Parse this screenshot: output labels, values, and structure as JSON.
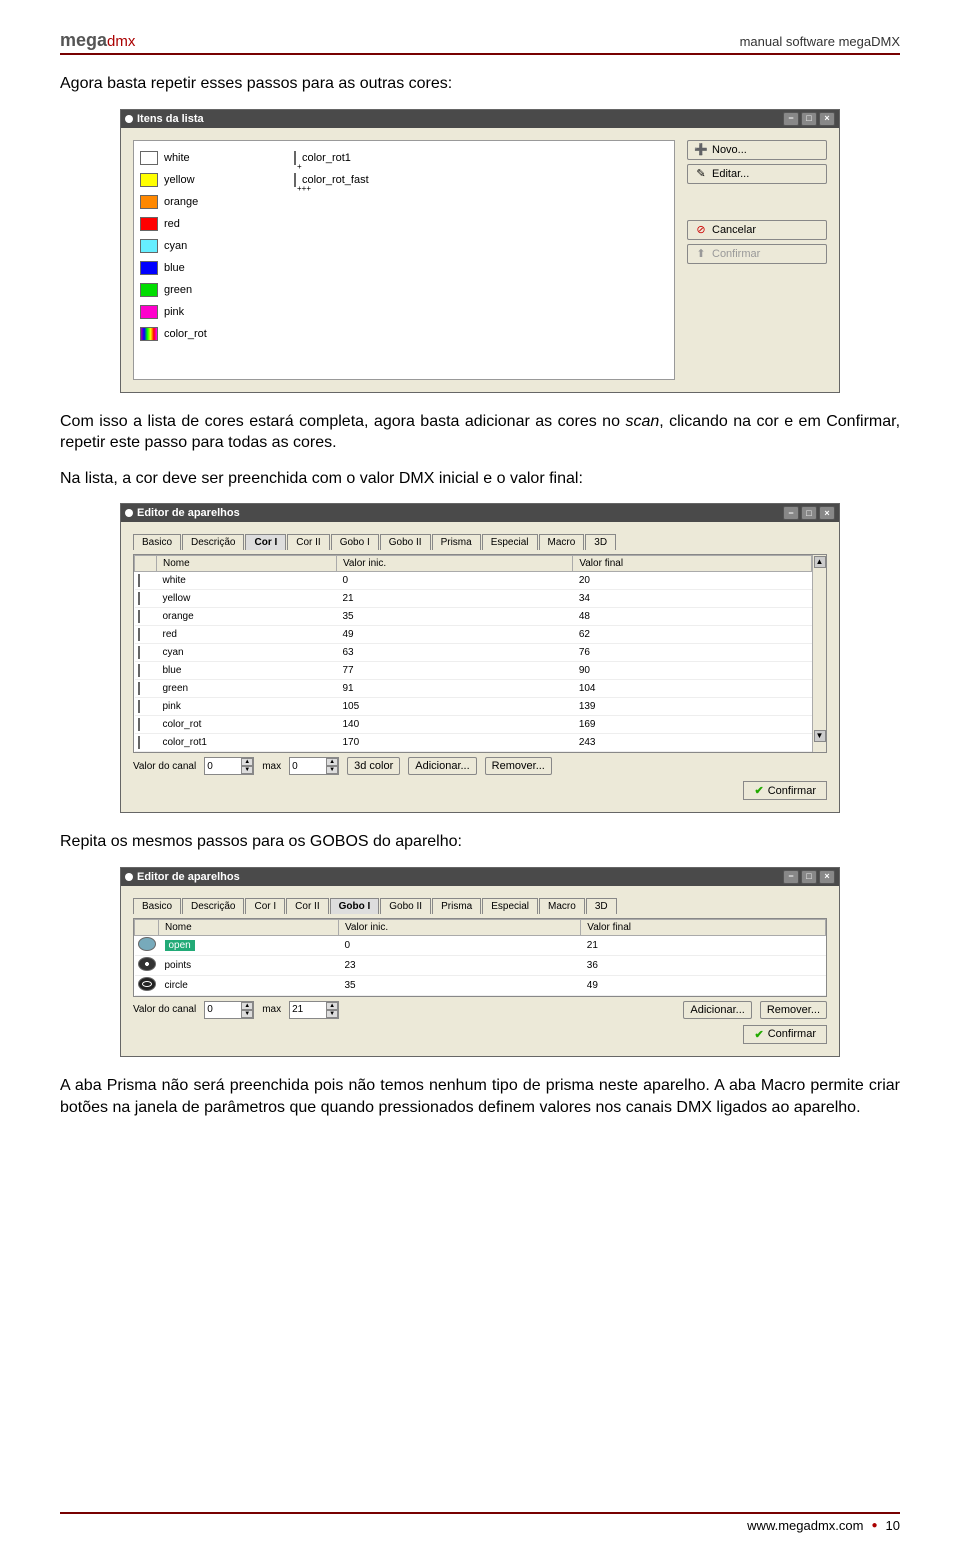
{
  "header": {
    "logo_mega": "mega",
    "logo_dmx": "dmx",
    "right": "manual software megaDMX"
  },
  "p1": "Agora basta repetir esses passos para as outras cores:",
  "p2a": "Com isso a lista de cores estará completa, agora basta adicionar as cores no ",
  "p2_scan": "scan",
  "p2b": ", clicando na cor e em Confirmar, repetir este passo para todas as cores.",
  "p3": "Na lista, a cor deve ser preenchida com o valor DMX inicial e o valor final:",
  "p4": "Repita os mesmos passos para os GOBOS do aparelho:",
  "p5": "A aba Prisma não será preenchida pois não temos nenhum tipo de prisma neste aparelho. A aba Macro permite criar botões na janela de parâmetros que quando pressionados definem valores nos canais DMX ligados ao aparelho.",
  "footer": {
    "url": "www.megadmx.com",
    "page": "10"
  },
  "win1": {
    "title": "Itens da lista",
    "col1": [
      {
        "name": "white",
        "color": "#ffffff"
      },
      {
        "name": "yellow",
        "color": "#ffff00"
      },
      {
        "name": "orange",
        "color": "#ff8800"
      },
      {
        "name": "red",
        "color": "#ff0000"
      },
      {
        "name": "cyan",
        "color": "#66eeff"
      },
      {
        "name": "blue",
        "color": "#0000ff"
      },
      {
        "name": "green",
        "color": "#00dd00"
      },
      {
        "name": "pink",
        "color": "#ff00cc"
      },
      {
        "name": "color_rot",
        "color": "multi"
      }
    ],
    "col2": [
      {
        "name": "color_rot1",
        "color": "multi",
        "sub": "+"
      },
      {
        "name": "color_rot_fast",
        "color": "multi",
        "sub": "+++"
      }
    ],
    "buttons": {
      "novo": "Novo...",
      "editar": "Editar...",
      "cancelar": "Cancelar",
      "confirmar": "Confirmar"
    }
  },
  "win2": {
    "title": "Editor de aparelhos",
    "tabs": [
      "Basico",
      "Descrição",
      "Cor I",
      "Cor II",
      "Gobo I",
      "Gobo II",
      "Prisma",
      "Especial",
      "Macro",
      "3D"
    ],
    "active_tab": 2,
    "headers": {
      "nome": "Nome",
      "vini": "Valor inic.",
      "vfin": "Valor final"
    },
    "rows": [
      {
        "name": "white",
        "color": "#ffffff",
        "v1": "0",
        "v2": "20"
      },
      {
        "name": "yellow",
        "color": "#ffff00",
        "v1": "21",
        "v2": "34"
      },
      {
        "name": "orange",
        "color": "#ff8800",
        "v1": "35",
        "v2": "48"
      },
      {
        "name": "red",
        "color": "#ff0000",
        "v1": "49",
        "v2": "62"
      },
      {
        "name": "cyan",
        "color": "#66eeff",
        "v1": "63",
        "v2": "76"
      },
      {
        "name": "blue",
        "color": "#0000ff",
        "v1": "77",
        "v2": "90"
      },
      {
        "name": "green",
        "color": "#00dd00",
        "v1": "91",
        "v2": "104"
      },
      {
        "name": "pink",
        "color": "#ff00cc",
        "v1": "105",
        "v2": "139"
      },
      {
        "name": "color_rot",
        "color": "multi",
        "v1": "140",
        "v2": "169"
      },
      {
        "name": "color_rot1",
        "color": "multi",
        "v1": "170",
        "v2": "243"
      }
    ],
    "bottom": {
      "vdc": "Valor do canal",
      "vdc_val": "0",
      "max": "max",
      "max_val": "0",
      "color3d": "3d color",
      "add": "Adicionar...",
      "rem": "Remover..."
    },
    "confirm": "Confirmar"
  },
  "win3": {
    "title": "Editor de aparelhos",
    "tabs": [
      "Basico",
      "Descrição",
      "Cor I",
      "Cor II",
      "Gobo I",
      "Gobo II",
      "Prisma",
      "Especial",
      "Macro",
      "3D"
    ],
    "active_tab": 4,
    "headers": {
      "nome": "Nome",
      "vini": "Valor inic.",
      "vfin": "Valor final"
    },
    "rows": [
      {
        "name": "open",
        "kind": "open",
        "v1": "0",
        "v2": "21"
      },
      {
        "name": "points",
        "kind": "points",
        "v1": "23",
        "v2": "36"
      },
      {
        "name": "circle",
        "kind": "circle",
        "v1": "35",
        "v2": "49"
      }
    ],
    "bottom": {
      "vdc": "Valor do canal",
      "vdc_val": "0",
      "max": "max",
      "max_val": "21",
      "add": "Adicionar...",
      "rem": "Remover..."
    },
    "confirm": "Confirmar"
  }
}
